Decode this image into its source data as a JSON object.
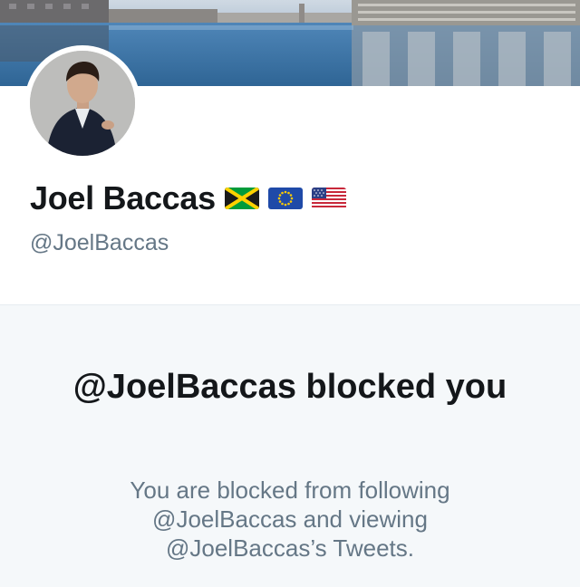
{
  "profile": {
    "display_name": "Joel Baccas",
    "handle": "@JoelBaccas",
    "flags": [
      "jamaica-flag-icon",
      "eu-flag-icon",
      "us-flag-icon"
    ]
  },
  "blocked": {
    "title": "@JoelBaccas blocked you",
    "description": "You are blocked from following @JoelBaccas and viewing @JoelBaccas’s Tweets."
  },
  "colors": {
    "name": "#14171a",
    "secondary_text": "#657786",
    "panel_background": "#f5f8fa"
  }
}
